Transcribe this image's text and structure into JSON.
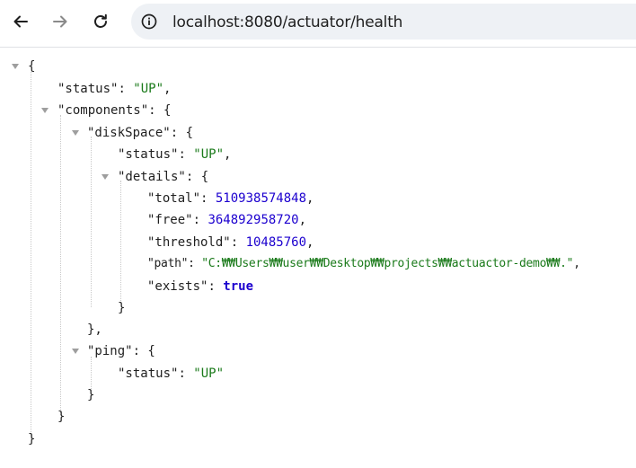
{
  "browser": {
    "url": "localhost:8080/actuator/health",
    "icons": {
      "back": "arrow-left-icon",
      "forward": "arrow-right-icon",
      "reload": "reload-icon",
      "site_info": "info-circle-icon"
    }
  },
  "json": {
    "status_key": "\"status\"",
    "status_value": "\"UP\"",
    "components_key": "\"components\"",
    "diskspace_key": "\"diskSpace\"",
    "diskspace_status_key": "\"status\"",
    "diskspace_status_value": "\"UP\"",
    "details_key": "\"details\"",
    "total_key": "\"total\"",
    "total_value": "510938574848",
    "free_key": "\"free\"",
    "free_value": "364892958720",
    "threshold_key": "\"threshold\"",
    "threshold_value": "10485760",
    "path_key": "\"path\"",
    "path_value": "\"C:₩₩Users₩₩user₩₩Desktop₩₩projects₩₩actuactor-demo₩₩.\"",
    "exists_key": "\"exists\"",
    "exists_value": "true",
    "ping_key": "\"ping\"",
    "ping_status_key": "\"status\"",
    "ping_status_value": "\"UP\""
  }
}
